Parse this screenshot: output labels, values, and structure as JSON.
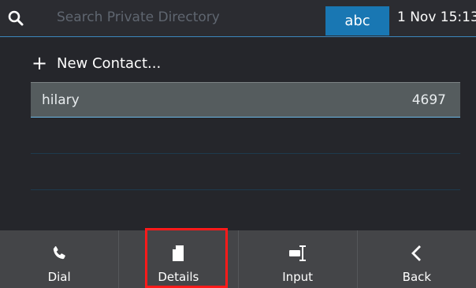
{
  "header": {
    "search_icon": "search-icon",
    "search_placeholder": "Search Private Directory",
    "input_mode": "abc",
    "datetime": "1 Nov 15:13"
  },
  "list": {
    "new_contact": {
      "icon": "plus-icon",
      "label": "New Contact..."
    },
    "contacts": [
      {
        "name": "hilary",
        "number": "4697"
      }
    ]
  },
  "softkeys": [
    {
      "icon": "phone-icon",
      "label": "Dial"
    },
    {
      "icon": "details-icon",
      "label": "Details"
    },
    {
      "icon": "input-icon",
      "label": "Input"
    },
    {
      "icon": "back-icon",
      "label": "Back"
    }
  ],
  "colors": {
    "background": "#25262b",
    "accent": "#1977b3",
    "selected_row": "#555c5e",
    "softkey_bar": "#444548",
    "highlight": "#ff1a1a"
  }
}
